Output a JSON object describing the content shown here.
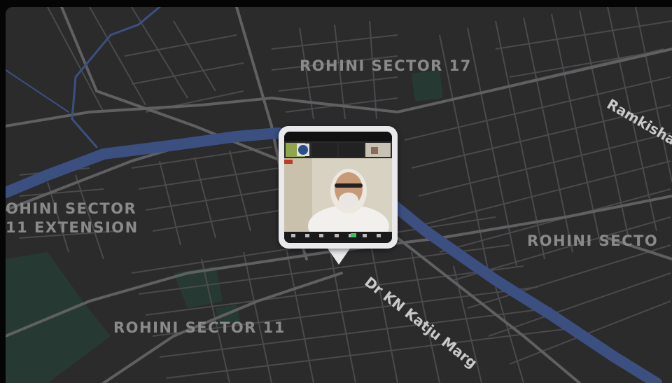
{
  "map": {
    "theme": "dark",
    "colors": {
      "background": "#2b2b2c",
      "road": "#545456",
      "water": "#3b4f80",
      "park": "#263a33",
      "label": "#8a8a8b"
    },
    "area_labels": [
      {
        "id": "rohini-sector-17",
        "text": "ROHINI SECTOR 17"
      },
      {
        "id": "rohini-sector-11-extension-line1",
        "text": "OHINI SECTOR"
      },
      {
        "id": "rohini-sector-11-extension-line2",
        "text": "11 EXTENSION"
      },
      {
        "id": "rohini-sector-right",
        "text": "ROHINI SECTO"
      },
      {
        "id": "rohini-sector-11",
        "text": "ROHINI SECTOR 11"
      }
    ],
    "street_labels": [
      {
        "id": "dr-kn-katju-marg",
        "text": "Dr KN Katju Marg"
      },
      {
        "id": "ramkisha",
        "text": "Ramkisha"
      }
    ]
  },
  "pin": {
    "thumbnail": {
      "subject": "video-call-screenshot",
      "toolbar_labels": [
        "Unmute",
        "Stop Video",
        "Participants",
        "Chat",
        "Share Screen",
        "Record",
        "Reactions",
        "Leave"
      ]
    }
  }
}
